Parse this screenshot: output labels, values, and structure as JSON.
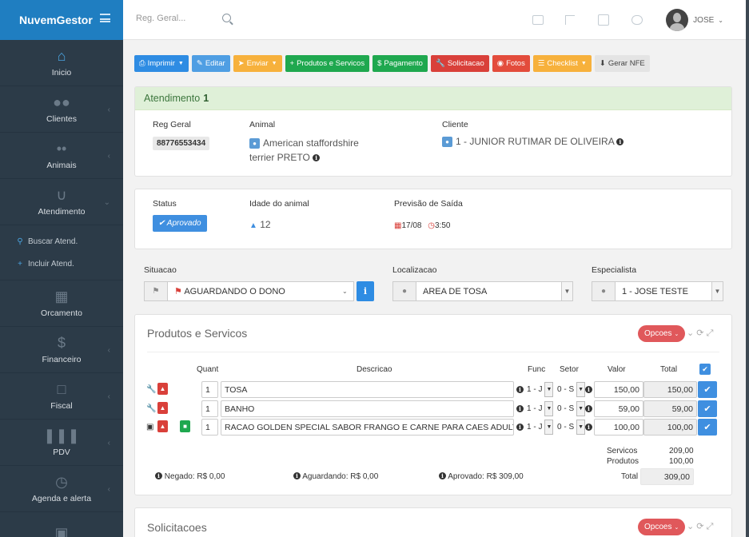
{
  "brand": {
    "name": "NuvemGestor"
  },
  "sidebar": {
    "items": [
      {
        "label": "Inicio",
        "icon": "home-icon"
      },
      {
        "label": "Clientes",
        "icon": "users-icon"
      },
      {
        "label": "Animais",
        "icon": "paw-icon"
      },
      {
        "label": "Atendimento",
        "icon": "stethoscope-icon"
      }
    ],
    "subitems": [
      {
        "label": "Buscar Atend.",
        "icon": "search-icon"
      },
      {
        "label": "Incluir Atend.",
        "icon": "plus-icon"
      }
    ],
    "items2": [
      {
        "label": "Orcamento",
        "icon": "calculator-icon"
      },
      {
        "label": "Financeiro",
        "icon": "dollar-icon"
      },
      {
        "label": "Fiscal",
        "icon": "file-icon"
      },
      {
        "label": "PDV",
        "icon": "barcode-icon"
      },
      {
        "label": "Agenda e alerta",
        "icon": "clock-icon"
      }
    ]
  },
  "topbar": {
    "search_placeholder": "Reg. Geral...",
    "user": "JOSE"
  },
  "toolbar": {
    "imprimir": "Imprimir",
    "editar": "Editar",
    "enviar": "Enviar",
    "produtos": "Produtos e Servicos",
    "pagamento": "Pagamento",
    "solicitacao": "Solicitacao",
    "fotos": "Fotos",
    "checklist": "Checklist",
    "gerar_nfe": "Gerar NFE"
  },
  "atendimento": {
    "title": "Atendimento",
    "number": "1",
    "reg_geral_label": "Reg Geral",
    "reg_geral": "88776553434",
    "animal_label": "Animal",
    "animal_line1": "American staffordshire",
    "animal_line2": "terrier PRETO",
    "cliente_label": "Cliente",
    "cliente": "1 - JUNIOR RUTIMAR DE OLIVEIRA"
  },
  "status": {
    "status_label": "Status",
    "status": "Aprovado",
    "idade_label": "Idade do animal",
    "idade": "12",
    "previsao_label": "Previsão de Saída",
    "data": "17/08",
    "hora": "3:50"
  },
  "fields": {
    "situacao_label": "Situacao",
    "situacao": "AGUARDANDO O DONO",
    "localizacao_label": "Localizacao",
    "localizacao": "AREA DE TOSA",
    "especialista_label": "Especialista",
    "especialista": "1 - JOSE TESTE"
  },
  "produtos": {
    "title": "Produtos e Servicos",
    "opcoes": "Opcoes",
    "headers": {
      "quant": "Quant",
      "descricao": "Descricao",
      "func": "Func",
      "setor": "Setor",
      "valor": "Valor",
      "total": "Total"
    },
    "rows": [
      {
        "quant": "1",
        "descricao": "TOSA",
        "func": "1 - J",
        "setor": "0 - S",
        "valor": "150,00",
        "total": "150,00"
      },
      {
        "quant": "1",
        "descricao": "BANHO",
        "func": "1 - J",
        "setor": "0 - S",
        "valor": "59,00",
        "total": "59,00"
      },
      {
        "quant": "1",
        "descricao": "RACAO GOLDEN SPECIAL SABOR FRANGO E CARNE PARA CAES ADULTOS",
        "func": "1 - J",
        "setor": "0 - S",
        "valor": "100,00",
        "total": "100,00"
      }
    ],
    "servicos_label": "Servicos",
    "servicos": "209,00",
    "produtos_label": "Produtos",
    "produtos_val": "100,00",
    "total_label": "Total",
    "total": "309,00",
    "negado": "Negado: R$ 0,00",
    "aguardando": "Aguardando: R$ 0,00",
    "aprovado": "Aprovado: R$ 309,00"
  },
  "solicitacoes": {
    "title": "Solicitacoes",
    "opcoes": "Opcoes"
  }
}
